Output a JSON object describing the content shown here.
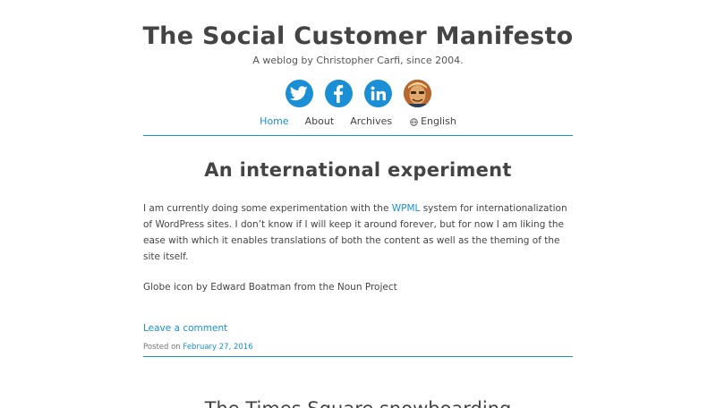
{
  "header": {
    "title": "The Social Customer Manifesto",
    "tagline": "A weblog by Christopher Carfi, since 2004."
  },
  "social": [
    "twitter-icon",
    "facebook-icon",
    "linkedin-icon",
    "avatar"
  ],
  "nav": {
    "home": "Home",
    "about": "About",
    "archives": "Archives",
    "language": "English"
  },
  "post": {
    "title": "An international experiment",
    "body_pre": "I am currently doing some experimentation with the ",
    "body_link": "WPML",
    "body_post": " system for internationalization of WordPress sites. I don’t know if I will keep it around forever, but for now I am liking the ease with which it enables translations of both the content as well as the theming of the site itself.",
    "credit": "Globe icon by Edward Boatman from the Noun Project",
    "comment_link": "Leave a comment",
    "posted_prefix": "Posted on ",
    "posted_date": "February 27, 2016"
  },
  "next_post": {
    "title": "The Times Square snowboarding"
  },
  "colors": {
    "accent": "#1a8fd6",
    "text": "#444444"
  }
}
